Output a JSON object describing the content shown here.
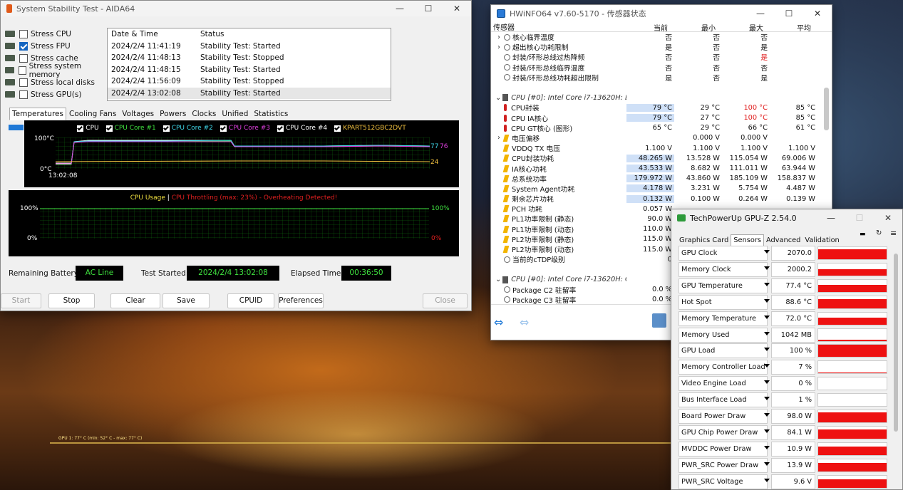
{
  "taskbar_text": "GPU 1: 77° C (min: 52° C - max: 77° C)",
  "aida": {
    "title": "System Stability Test - AIDA64",
    "options": [
      {
        "label": "Stress CPU",
        "checked": false
      },
      {
        "label": "Stress FPU",
        "checked": true
      },
      {
        "label": "Stress cache",
        "checked": false
      },
      {
        "label": "Stress system memory",
        "checked": false
      },
      {
        "label": "Stress local disks",
        "checked": false
      },
      {
        "label": "Stress GPU(s)",
        "checked": false
      }
    ],
    "log_headers": [
      "Date & Time",
      "Status"
    ],
    "log": [
      {
        "dt": "2024/2/4 11:41:19",
        "status": "Stability Test: Started"
      },
      {
        "dt": "2024/2/4 11:48:13",
        "status": "Stability Test: Stopped"
      },
      {
        "dt": "2024/2/4 11:48:15",
        "status": "Stability Test: Started"
      },
      {
        "dt": "2024/2/4 11:56:09",
        "status": "Stability Test: Stopped"
      },
      {
        "dt": "2024/2/4 13:02:08",
        "status": "Stability Test: Started"
      }
    ],
    "tabs": [
      "Temperatures",
      "Cooling Fans",
      "Voltages",
      "Powers",
      "Clocks",
      "Unified",
      "Statistics"
    ],
    "temp_legend": [
      {
        "label": "CPU",
        "color": "#ffffff"
      },
      {
        "label": "CPU Core #1",
        "color": "#3fe23f"
      },
      {
        "label": "CPU Core #2",
        "color": "#3fd6e8"
      },
      {
        "label": "CPU Core #3",
        "color": "#e040e0"
      },
      {
        "label": "CPU Core #4",
        "color": "#ffffff"
      },
      {
        "label": "KPART512GBC2DVT",
        "color": "#f0c040"
      }
    ],
    "temp_axis": {
      "top": "100°C",
      "bottom": "0°C",
      "time": "13:02:08",
      "right_a": "77",
      "right_b": "76",
      "right_c": "24"
    },
    "usage": {
      "title_a": "CPU Usage",
      "sep": "|",
      "title_b": "CPU Throttling (max: 23%) - Overheating Detected!",
      "top_left": "100%",
      "bottom_left": "0%",
      "top_right": "100%",
      "bottom_right": "0%"
    },
    "status": {
      "battery_label": "Remaining Battery:",
      "battery_value": "AC Line",
      "started_label": "Test Started:",
      "started_value": "2024/2/4 13:02:08",
      "elapsed_label": "Elapsed Time:",
      "elapsed_value": "00:36:50"
    },
    "buttons": {
      "start": "Start",
      "stop": "Stop",
      "clear": "Clear",
      "save": "Save",
      "cpuid": "CPUID",
      "prefs": "Preferences",
      "close": "Close"
    }
  },
  "hwinfo": {
    "title": "HWiNFO64 v7.60-5170 - 传感器状态",
    "headers": [
      "传感器",
      "当前",
      "最小",
      "最大",
      "平均"
    ],
    "rows": [
      {
        "name": "核心临界温度",
        "icon": "o",
        "chev": true,
        "v": [
          "否",
          "否",
          "否",
          ""
        ]
      },
      {
        "name": "超出核心功耗限制",
        "icon": "o",
        "chev": true,
        "v": [
          "是",
          "否",
          "是",
          ""
        ]
      },
      {
        "name": "封装/环形总线过热降频",
        "icon": "o",
        "v": [
          "否",
          "否",
          "是",
          ""
        ],
        "red_max": true
      },
      {
        "name": "封装/环形总线临界温度",
        "icon": "o",
        "v": [
          "否",
          "否",
          "否",
          ""
        ]
      },
      {
        "name": "封装/环形总线功耗超出限制",
        "icon": "o",
        "v": [
          "是",
          "否",
          "是",
          ""
        ]
      },
      {
        "blank": true
      },
      {
        "name": "CPU [#0]: Intel Core i7-13620H: E...",
        "icon": "c",
        "group": true,
        "chev": "v",
        "v": [
          "",
          "",
          "",
          ""
        ]
      },
      {
        "name": "CPU封装",
        "icon": "t",
        "v": [
          "79 °C",
          "29 °C",
          "100 °C",
          "85 °C"
        ],
        "hl": true,
        "red_max": true
      },
      {
        "name": "CPU IA核心",
        "icon": "t",
        "v": [
          "79 °C",
          "27 °C",
          "100 °C",
          "85 °C"
        ],
        "hl": true,
        "red_max": true
      },
      {
        "name": "CPU GT核心 (图形)",
        "icon": "t",
        "v": [
          "65 °C",
          "29 °C",
          "66 °C",
          "61 °C"
        ]
      },
      {
        "name": "电压偏移",
        "icon": "b",
        "chev": true,
        "v": [
          "",
          "0.000 V",
          "0.000 V",
          ""
        ]
      },
      {
        "name": "VDDQ TX 电压",
        "icon": "b",
        "v": [
          "1.100 V",
          "1.100 V",
          "1.100 V",
          "1.100 V"
        ]
      },
      {
        "name": "CPU封装功耗",
        "icon": "b",
        "v": [
          "48.265 W",
          "13.528 W",
          "115.054 W",
          "69.006 W"
        ],
        "hl": true
      },
      {
        "name": "IA核心功耗",
        "icon": "b",
        "v": [
          "43.533 W",
          "8.682 W",
          "111.011 W",
          "63.944 W"
        ],
        "hl": true
      },
      {
        "name": "总系统功率",
        "icon": "b",
        "v": [
          "179.972 W",
          "43.860 W",
          "185.109 W",
          "158.837 W"
        ],
        "hl": true
      },
      {
        "name": "System Agent功耗",
        "icon": "b",
        "v": [
          "4.178 W",
          "3.231 W",
          "5.754 W",
          "4.487 W"
        ],
        "hl": true
      },
      {
        "name": "剩余芯片功耗",
        "icon": "b",
        "v": [
          "0.132 W",
          "0.100 W",
          "0.264 W",
          "0.139 W"
        ],
        "hl": true
      },
      {
        "name": "PCH 功耗",
        "icon": "b",
        "v": [
          "0.057 W",
          "",
          "",
          ""
        ]
      },
      {
        "name": "PL1功率限制 (静态)",
        "icon": "b",
        "v": [
          "90.0 W",
          "",
          "",
          ""
        ]
      },
      {
        "name": "PL1功率限制 (动态)",
        "icon": "b",
        "v": [
          "110.0 W",
          "",
          "",
          ""
        ]
      },
      {
        "name": "PL2功率限制 (静态)",
        "icon": "b",
        "v": [
          "115.0 W",
          "",
          "",
          ""
        ]
      },
      {
        "name": "PL2功率限制 (动态)",
        "icon": "b",
        "v": [
          "115.0 W",
          "",
          "",
          ""
        ]
      },
      {
        "name": "当前的cTDP级别",
        "icon": "o",
        "v": [
          "0",
          "",
          "",
          ""
        ]
      },
      {
        "blank": true
      },
      {
        "name": "CPU [#0]: Intel Core i7-13620H: C...",
        "icon": "c",
        "group": true,
        "chev": "v",
        "v": [
          "",
          "",
          "",
          ""
        ]
      },
      {
        "name": "Package C2 驻留率",
        "icon": "o",
        "v": [
          "0.0 %",
          "",
          "",
          ""
        ]
      },
      {
        "name": "Package C3 驻留率",
        "icon": "o",
        "v": [
          "0.0 %",
          "",
          "",
          ""
        ]
      }
    ]
  },
  "gpuz": {
    "title": "TechPowerUp GPU-Z 2.54.0",
    "tabs": [
      "Graphics Card",
      "Sensors",
      "Advanced",
      "Validation"
    ],
    "sensors": [
      {
        "label": "GPU Clock",
        "value": "2070.0 MHz",
        "level": 0.85
      },
      {
        "label": "Memory Clock",
        "value": "2000.2 MHz",
        "level": 0.55
      },
      {
        "label": "GPU Temperature",
        "value": "77.4 °C",
        "level": 0.6
      },
      {
        "label": "Hot Spot",
        "value": "88.6 °C",
        "level": 0.75
      },
      {
        "label": "Memory Temperature",
        "value": "72.0 °C",
        "level": 0.55
      },
      {
        "label": "Memory Used",
        "value": "1042 MB",
        "level": 0.08
      },
      {
        "label": "GPU Load",
        "value": "100 %",
        "level": 1.0
      },
      {
        "label": "Memory Controller Load",
        "value": "7 %",
        "level": 0.08
      },
      {
        "label": "Video Engine Load",
        "value": "0 %",
        "level": 0.0
      },
      {
        "label": "Bus Interface Load",
        "value": "1 %",
        "level": 0.03
      },
      {
        "label": "Board Power Draw",
        "value": "98.0 W",
        "level": 0.8
      },
      {
        "label": "GPU Chip Power Draw",
        "value": "84.1 W",
        "level": 0.75
      },
      {
        "label": "MVDDC Power Draw",
        "value": "10.9 W",
        "level": 0.7
      },
      {
        "label": "PWR_SRC Power Draw",
        "value": "13.9 W",
        "level": 0.7
      },
      {
        "label": "PWR_SRC Voltage",
        "value": "9.6 V",
        "level": 0.7
      }
    ]
  }
}
